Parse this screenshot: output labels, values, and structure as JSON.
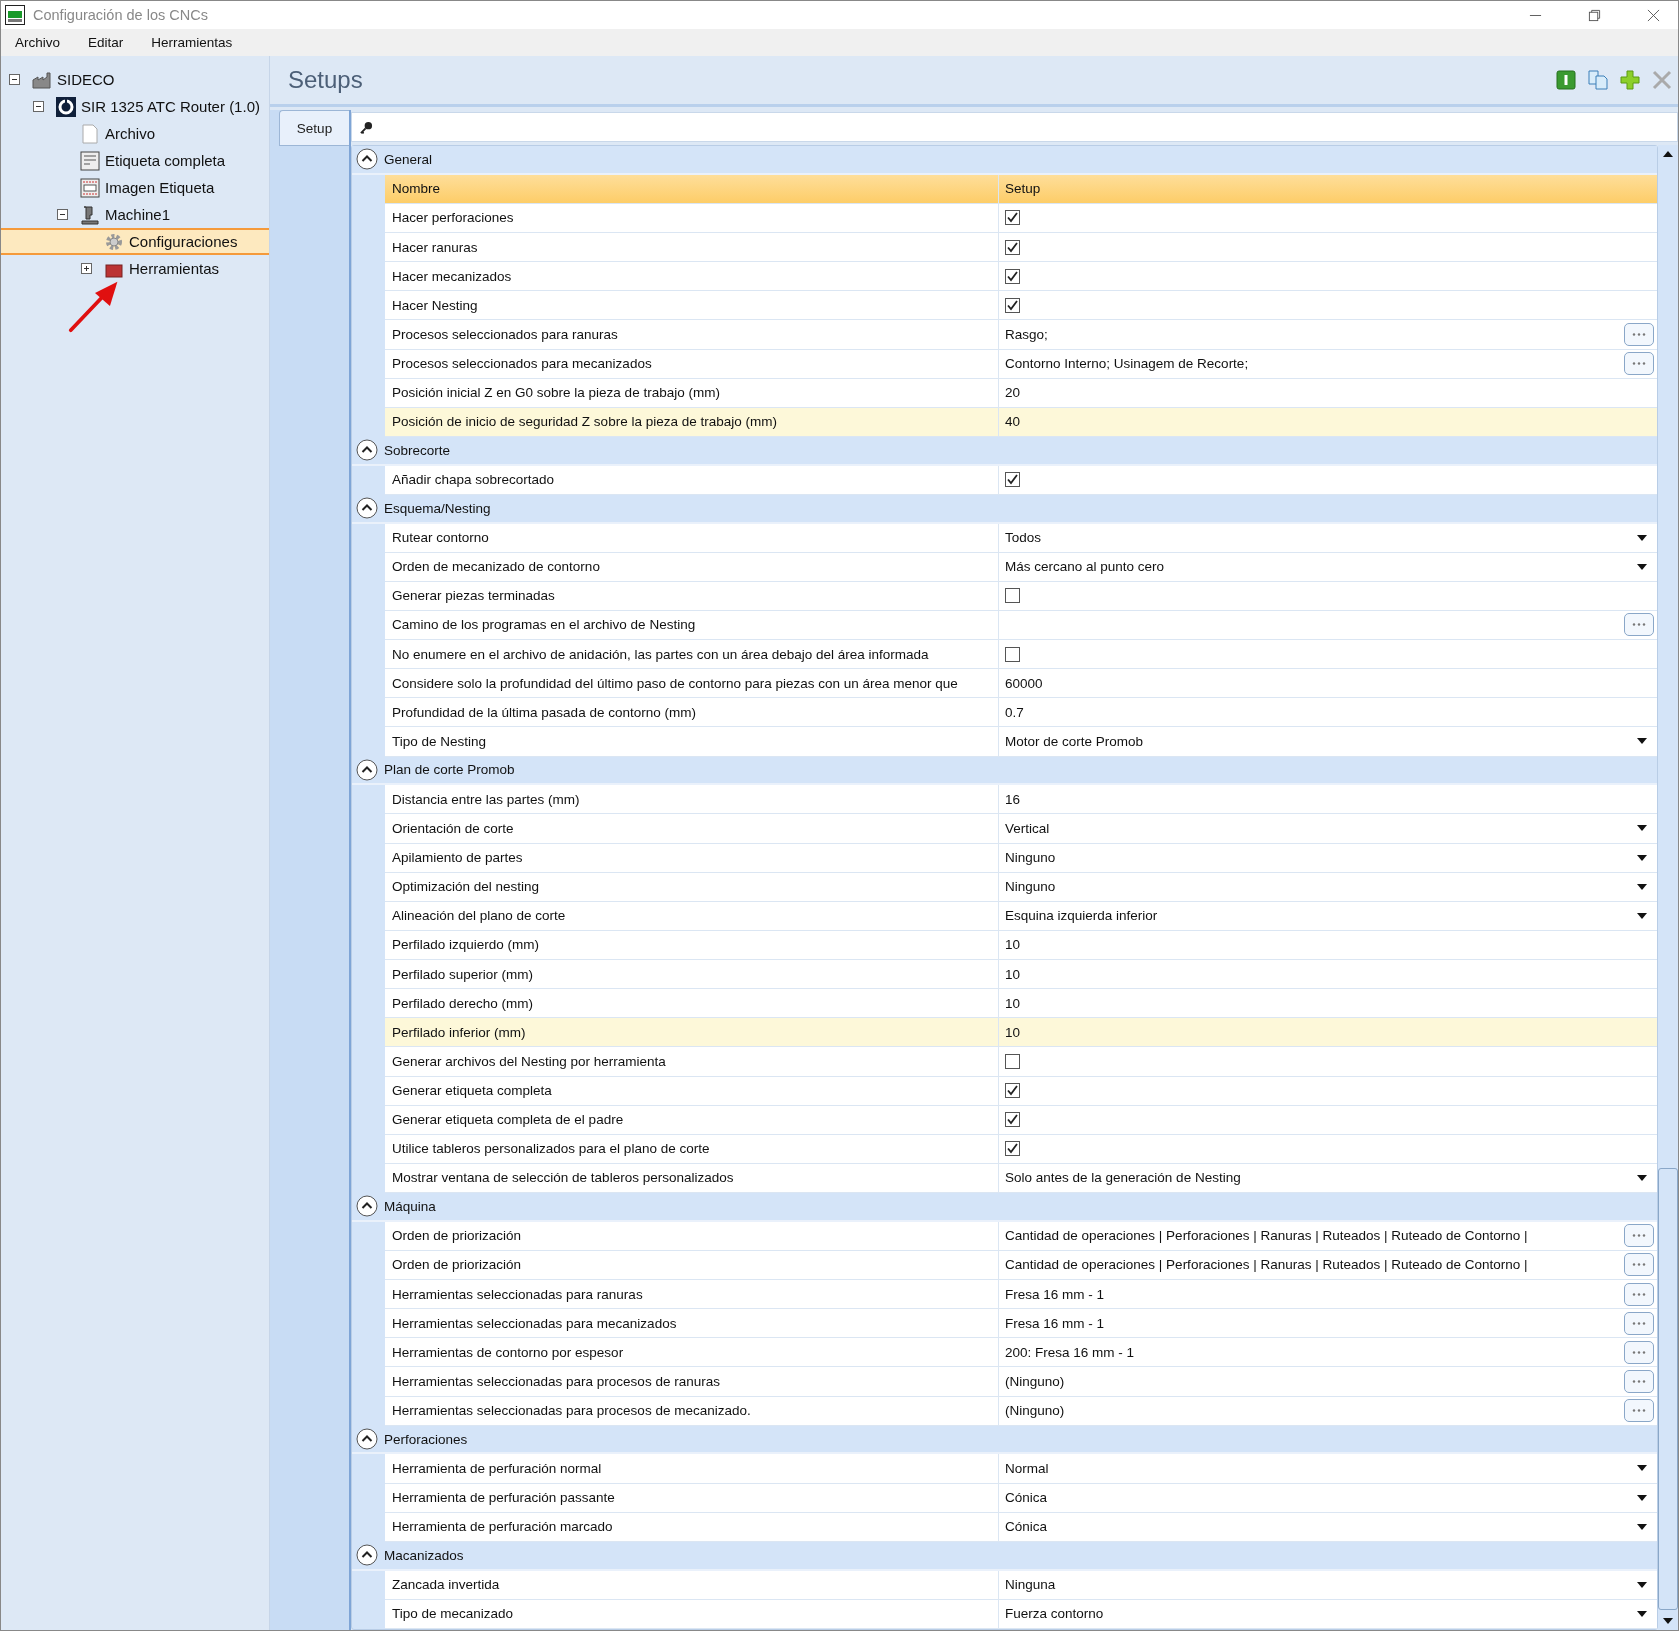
{
  "window": {
    "title": "Configuración de los CNCs"
  },
  "menu": [
    "Archivo",
    "Editar",
    "Herramientas"
  ],
  "tree": [
    {
      "label": "SIDECO",
      "kind": "factory",
      "expanded": true,
      "selected": false,
      "children": [
        {
          "label": "SIR 1325 ATC Router (1.0)",
          "kind": "logo",
          "expanded": true,
          "selected": false,
          "children": [
            {
              "label": "Archivo",
              "kind": "file",
              "selected": false
            },
            {
              "label": "Etiqueta completa",
              "kind": "label",
              "selected": false
            },
            {
              "label": "Imagen Etiqueta",
              "kind": "image",
              "selected": false
            },
            {
              "label": "Machine1",
              "kind": "machine",
              "expanded": true,
              "selected": false,
              "children": [
                {
                  "label": "Configuraciones",
                  "kind": "gear",
                  "selected": true
                },
                {
                  "label": "Herramientas",
                  "kind": "tools",
                  "expanded": false,
                  "selected": false
                }
              ]
            }
          ]
        }
      ]
    }
  ],
  "panel": {
    "title": "Setups",
    "tabs": [
      {
        "label": "Setup",
        "selected": true
      }
    ]
  },
  "grid": {
    "columns": [
      "Nombre",
      "Setup"
    ],
    "groups": [
      {
        "title": "General",
        "expanded": true,
        "rows": [
          {
            "name": "Hacer perforaciones",
            "kind": "checkbox",
            "checked": true,
            "highlighted": false
          },
          {
            "name": "Hacer ranuras",
            "kind": "checkbox",
            "checked": true,
            "highlighted": false
          },
          {
            "name": "Hacer mecanizados",
            "kind": "checkbox",
            "checked": true,
            "highlighted": false
          },
          {
            "name": "Hacer Nesting",
            "kind": "checkbox",
            "checked": true,
            "highlighted": false
          },
          {
            "name": "Procesos seleccionados para ranuras",
            "kind": "picker",
            "value": "Rasgo;",
            "highlighted": false
          },
          {
            "name": "Procesos seleccionados para mecanizados",
            "kind": "picker",
            "value": "Contorno Interno; Usinagem de Recorte;",
            "highlighted": false
          },
          {
            "name": "Posición inicial Z en G0 sobre la pieza de trabajo (mm)",
            "kind": "text",
            "value": "20",
            "highlighted": false
          },
          {
            "name": "Posición de inicio de seguridad Z sobre la pieza de trabajo (mm)",
            "kind": "text",
            "value": "40",
            "highlighted": true
          }
        ]
      },
      {
        "title": "Sobrecorte",
        "expanded": true,
        "rows": [
          {
            "name": "Añadir chapa sobrecortado",
            "kind": "checkbox",
            "checked": true,
            "highlighted": false
          }
        ]
      },
      {
        "title": "Esquema/Nesting",
        "expanded": true,
        "rows": [
          {
            "name": "Rutear contorno",
            "kind": "dropdown",
            "value": "Todos",
            "highlighted": false
          },
          {
            "name": "Orden de mecanizado de contorno",
            "kind": "dropdown",
            "value": "Más cercano al punto cero",
            "highlighted": false
          },
          {
            "name": "Generar piezas terminadas",
            "kind": "checkbox",
            "checked": false,
            "highlighted": false
          },
          {
            "name": "Camino de los programas en el archivo de Nesting",
            "kind": "picker",
            "highlighted": false
          },
          {
            "name": "No enumere en el archivo de anidación, las partes con un área debajo del área informada",
            "kind": "checkbox",
            "checked": false,
            "highlighted": false
          },
          {
            "name": "Considere solo la profundidad del último paso de contorno para piezas con un área menor que",
            "kind": "text",
            "value": "60000",
            "highlighted": false
          },
          {
            "name": "Profundidad de la última pasada de contorno (mm)",
            "kind": "text",
            "value": "0.7",
            "highlighted": false
          },
          {
            "name": "Tipo de Nesting",
            "kind": "dropdown",
            "value": "Motor de corte Promob",
            "highlighted": false
          }
        ]
      },
      {
        "title": "Plan de corte Promob",
        "expanded": true,
        "rows": [
          {
            "name": "Distancia entre las partes (mm)",
            "kind": "text",
            "value": "16",
            "highlighted": false
          },
          {
            "name": "Orientación de corte",
            "kind": "dropdown",
            "value": "Vertical",
            "highlighted": false
          },
          {
            "name": "Apilamiento de partes",
            "kind": "dropdown",
            "value": "Ninguno",
            "highlighted": false
          },
          {
            "name": "Optimización del nesting",
            "kind": "dropdown",
            "value": "Ninguno",
            "highlighted": false
          },
          {
            "name": "Alineación del plano de corte",
            "kind": "dropdown",
            "value": "Esquina izquierda inferior",
            "highlighted": false
          },
          {
            "name": "Perfilado izquierdo (mm)",
            "kind": "text",
            "value": "10",
            "highlighted": false
          },
          {
            "name": "Perfilado superior (mm)",
            "kind": "text",
            "value": "10",
            "highlighted": false
          },
          {
            "name": "Perfilado derecho (mm)",
            "kind": "text",
            "value": "10",
            "highlighted": false
          },
          {
            "name": "Perfilado inferior (mm)",
            "kind": "text",
            "value": "10",
            "highlighted": true
          },
          {
            "name": "Generar archivos del Nesting por herramienta",
            "kind": "checkbox",
            "checked": false,
            "highlighted": false
          },
          {
            "name": "Generar etiqueta completa",
            "kind": "checkbox",
            "checked": true,
            "highlighted": false
          },
          {
            "name": "Generar etiqueta completa de el padre",
            "kind": "checkbox",
            "checked": true,
            "highlighted": false
          },
          {
            "name": "Utilice tableros personalizados para el plano de corte",
            "kind": "checkbox",
            "checked": true,
            "highlighted": false
          },
          {
            "name": "Mostrar ventana de selección de tableros personalizados",
            "kind": "dropdown",
            "value": "Solo antes de la generación de Nesting",
            "highlighted": false
          }
        ]
      },
      {
        "title": "Máquina",
        "expanded": true,
        "rows": [
          {
            "name": "Orden de priorización",
            "kind": "picker",
            "value": "Cantidad de operaciones | Perforaciones | Ranuras | Ruteados | Ruteado de Contorno |",
            "highlighted": false
          },
          {
            "name": "Orden de priorización",
            "kind": "picker",
            "value": "Cantidad de operaciones | Perforaciones | Ranuras | Ruteados | Ruteado de Contorno |",
            "highlighted": false
          },
          {
            "name": "Herramientas seleccionadas para ranuras",
            "kind": "picker",
            "value": "Fresa 16 mm - 1",
            "highlighted": false
          },
          {
            "name": "Herramientas seleccionadas para mecanizados",
            "kind": "picker",
            "value": "Fresa 16 mm - 1",
            "highlighted": false
          },
          {
            "name": "Herramientas de contorno por espesor",
            "kind": "picker",
            "value": "200: Fresa 16 mm - 1",
            "highlighted": false
          },
          {
            "name": "Herramientas seleccionadas para procesos de ranuras",
            "kind": "picker",
            "value": "(Ninguno)",
            "highlighted": false
          },
          {
            "name": "Herramientas seleccionadas para procesos de mecanizado.",
            "kind": "picker",
            "value": "(Ninguno)",
            "highlighted": false
          }
        ]
      },
      {
        "title": "Perforaciones",
        "expanded": true,
        "rows": [
          {
            "name": "Herramienta de perfuración normal",
            "kind": "dropdown",
            "value": "Normal",
            "highlighted": false
          },
          {
            "name": "Herramienta de perfuración passante",
            "kind": "dropdown",
            "value": "Cónica",
            "highlighted": false
          },
          {
            "name": "Herramienta de perfuración marcado",
            "kind": "dropdown",
            "value": "Cónica",
            "highlighted": false
          }
        ]
      },
      {
        "title": "Macanizados",
        "expanded": true,
        "rows": [
          {
            "name": "Zancada invertida",
            "kind": "dropdown",
            "value": "Ninguna",
            "highlighted": false
          },
          {
            "name": "Tipo de mecanizado",
            "kind": "dropdown",
            "value": "Fuerza contorno",
            "highlighted": false
          }
        ]
      }
    ]
  }
}
